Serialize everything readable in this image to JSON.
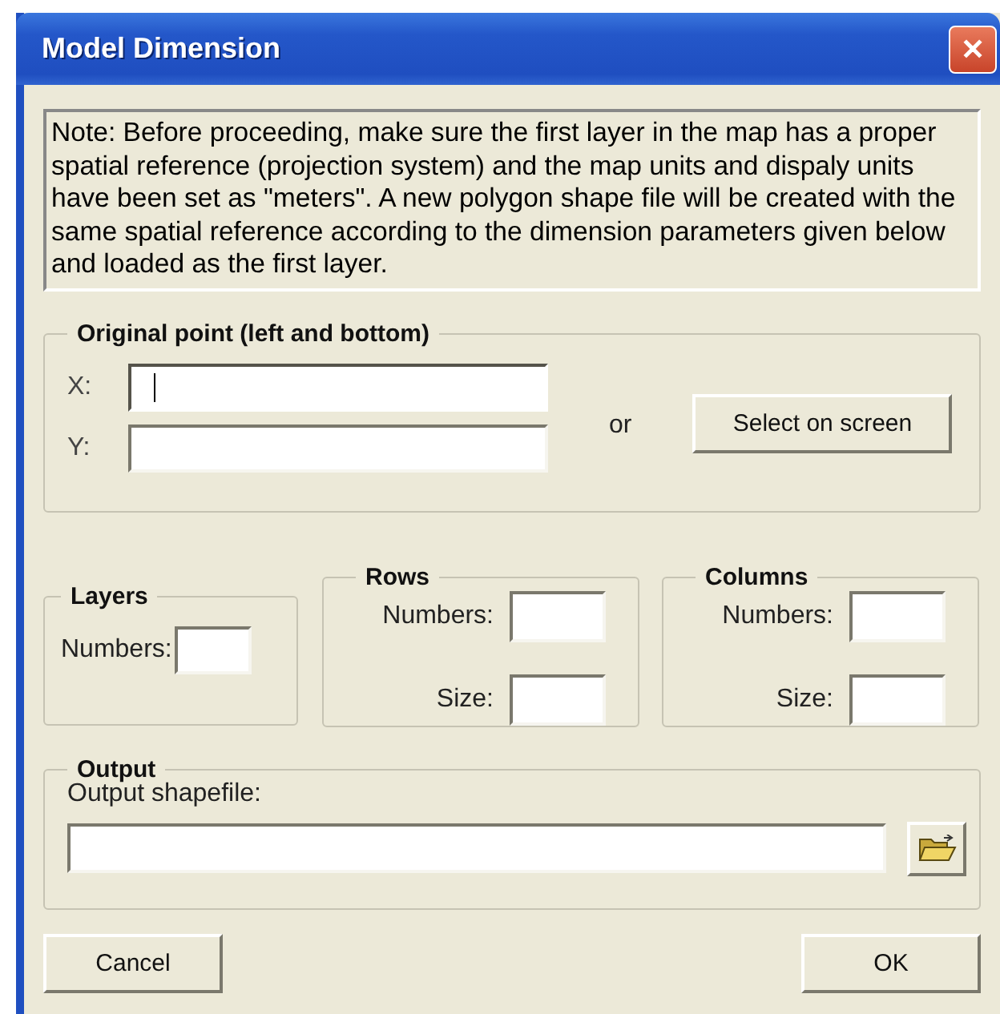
{
  "window": {
    "title": "Model Dimension",
    "close": "✕"
  },
  "note": "Note: Before proceeding, make sure the first layer in the map has a proper spatial reference (projection system) and the map units and dispaly units have been set as \"meters\". A new polygon shape file will be created with the same spatial reference according to the dimension parameters given below and loaded as the first layer.",
  "origin": {
    "title": "Original point (left and bottom)",
    "fields": [
      {
        "label": "X:",
        "focused": true
      },
      {
        "label": "Y:",
        "focused": false
      }
    ],
    "or": "or",
    "button": "Select on screen"
  },
  "layers": {
    "title": "Layers",
    "numbers_label": "Numbers:"
  },
  "rows": {
    "title": "Rows",
    "numbers_label": "Numbers:",
    "size_label": "Size:"
  },
  "columns": {
    "title": "Columns",
    "numbers_label": "Numbers:",
    "size_label": "Size:"
  },
  "output": {
    "title": "Output",
    "label": "Output shapefile:"
  },
  "buttons": {
    "cancel": "Cancel",
    "ok": "OK"
  }
}
